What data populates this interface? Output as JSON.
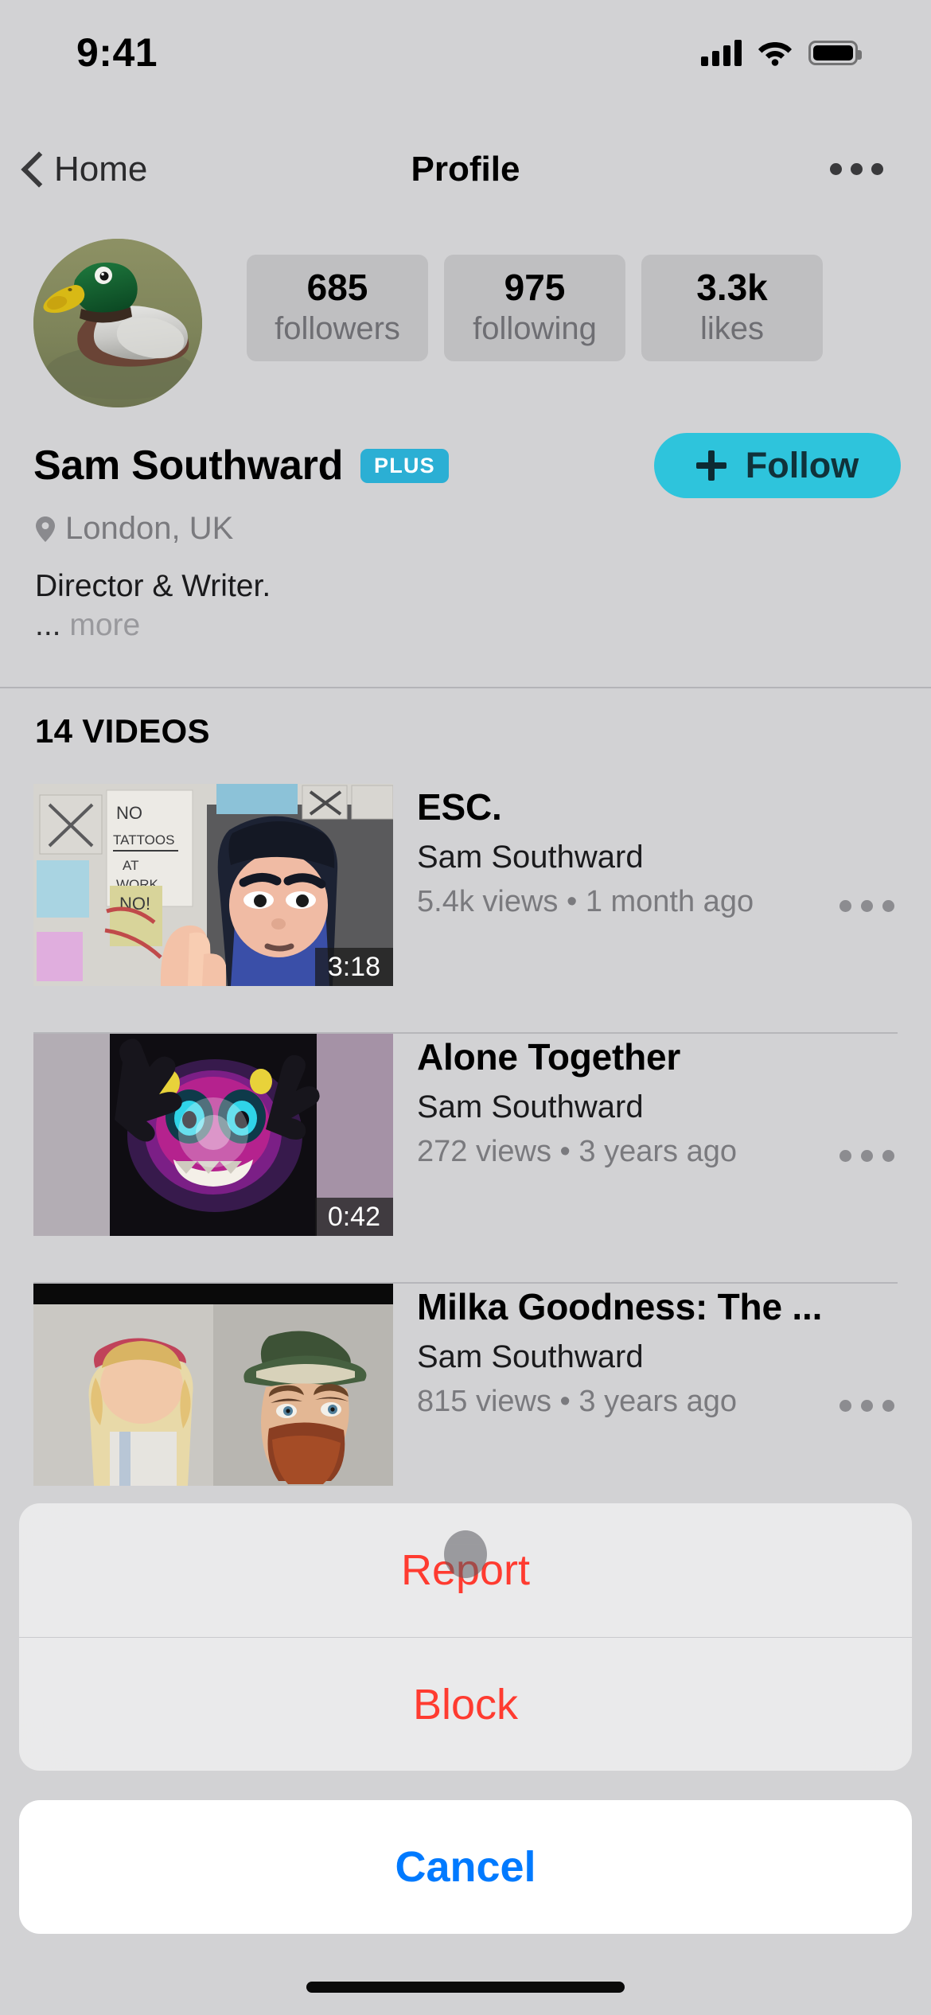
{
  "status_bar": {
    "time": "9:41",
    "signal_icon": "cellular-signal-icon",
    "wifi_icon": "wifi-icon",
    "battery_icon": "battery-full-icon"
  },
  "nav_bar": {
    "back_label": "Home",
    "back_icon": "chevron-left-icon",
    "title": "Profile",
    "more_icon": "ellipsis-icon"
  },
  "profile": {
    "avatar_alt": "mallard-duck-photo",
    "display_name": "Sam Southward",
    "badge": "PLUS",
    "badge_color": "#2BAFD4",
    "location": "London, UK",
    "location_icon": "map-pin-icon",
    "bio": "Director & Writer.",
    "bio_more_dots": "... ",
    "bio_more_label": "more",
    "follow_label": "Follow",
    "follow_icon": "plus-icon",
    "follow_color": "#2EC4DC",
    "stats": [
      {
        "value": "685",
        "label": "followers"
      },
      {
        "value": "975",
        "label": "following"
      },
      {
        "value": "3.3k",
        "label": "likes"
      }
    ]
  },
  "videos_section": {
    "header": "14 VIDEOS",
    "items": [
      {
        "title": "ESC.",
        "channel": "Sam Southward",
        "stats": "5.4k views • 1 month ago",
        "duration": "3:18",
        "thumbnail_alt": "animated-character-office-notes"
      },
      {
        "title": "Alone Together",
        "channel": "Sam Southward",
        "stats": "272 views • 3 years ago",
        "duration": "0:42",
        "thumbnail_alt": "glowing-monster-hands-dark"
      },
      {
        "title": "Milka Goodness: The ...",
        "channel": "Sam Southward",
        "stats": "815 views • 3 years ago",
        "duration": "",
        "thumbnail_alt": "bearded-man-green-hat-and-girl"
      }
    ]
  },
  "action_sheet": {
    "options": [
      {
        "label": "Report",
        "color": "#FF3B30"
      },
      {
        "label": "Block",
        "color": "#FF3B30"
      }
    ],
    "cancel_label": "Cancel",
    "cancel_color": "#007AFF"
  }
}
